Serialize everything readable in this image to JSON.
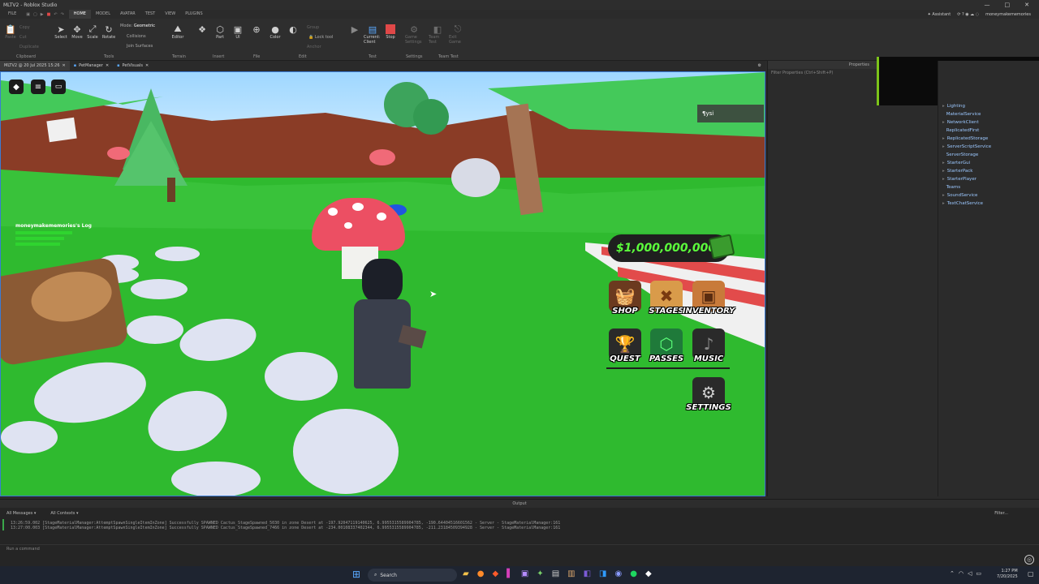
{
  "window": {
    "title": "MLTV2 - Roblox Studio",
    "min": "—",
    "max": "□",
    "close": "✕"
  },
  "menubar": {
    "file": "FILE",
    "tabs": [
      "HOME",
      "MODEL",
      "AVATAR",
      "TEST",
      "VIEW",
      "PLUGINS"
    ],
    "assistant": "Assistant",
    "user": "moneymakememories"
  },
  "ribbon": {
    "clipboard": [
      "Copy",
      "Cut",
      "Paste",
      "Duplicate"
    ],
    "tools": [
      "Select",
      "Move",
      "Scale",
      "Rotate"
    ],
    "mode_label": "Mode:",
    "mode_value": "Geometric",
    "collisions": "Collisions",
    "join_surfaces": "Join Surfaces",
    "terrain": "Editor",
    "insert": [
      "Part",
      "UI"
    ],
    "file": [
      "Import 3D"
    ],
    "edit": [
      "Material",
      "Color",
      "Group",
      "Lock"
    ],
    "lock_tool": "Lock tool",
    "anchor": "Anchor",
    "test": [
      "Play",
      "Current: Client",
      "Stop"
    ],
    "settings": "Game Settings",
    "team_test": [
      "Team Test",
      "Exit Game"
    ],
    "groups": [
      "Clipboard",
      "Tools",
      "Terrain",
      "Insert",
      "File",
      "Edit",
      "Test",
      "Settings",
      "Team Test"
    ]
  },
  "doc_tabs": [
    {
      "label": "MLTV2 @ 20 Jul 2025 15:26",
      "active": true
    },
    {
      "label": "PetManager",
      "active": false
    },
    {
      "label": "PetVisuals",
      "active": false
    }
  ],
  "game": {
    "chat_text": "ysi",
    "player_log": "moneymakememories's Log",
    "currency": "$1,000,000,000",
    "buttons": [
      {
        "label": "SHOP",
        "icon": "basket-icon"
      },
      {
        "label": "STAGES",
        "icon": "map-icon"
      },
      {
        "label": "INVENTORY",
        "icon": "backpack-icon"
      },
      {
        "label": "QUEST",
        "icon": "trophy-icon"
      },
      {
        "label": "PASSES",
        "icon": "pass-icon"
      },
      {
        "label": "MUSIC",
        "icon": "music-icon"
      },
      {
        "label": "SETTINGS",
        "icon": "gear-icon"
      }
    ]
  },
  "properties": {
    "title": "Properties",
    "filter": "Filter Properties (Ctrl+Shift+P)"
  },
  "explorer": {
    "items": [
      "Lighting",
      "MaterialService",
      "NetworkClient",
      "ReplicatedFirst",
      "ReplicatedStorage",
      "ServerScriptService",
      "ServerStorage",
      "StarterGui",
      "StarterPack",
      "StarterPlayer",
      "Teams",
      "SoundService",
      "TextChatService"
    ]
  },
  "output": {
    "title": "Output",
    "filter_messages": "All Messages",
    "filter_contexts": "All Contexts",
    "filter": "Filter...",
    "lines": [
      "13:26:59.002  [StageMaterialManager:AttemptSpawnSingleItemInZone] Successfully SPAWNED Cactus_StageSpawned_5030 in zone Desert at -197.92047119140625, 6.9955315589904785, -190.64404516601562  -  Server - StageMaterialManager:161",
      "13:27:00.003  [StageMaterialManager:AttemptSpawnSingleItemInZone] Successfully SPAWNED Cactus_StageSpawned_7466 in zone Desert at -234.00108337402344, 6.9955315589904785, -211.23184509394928  -  Server - StageMaterialManager:161"
    ],
    "command_placeholder": "Run a command"
  },
  "taskbar": {
    "search": "Search",
    "time": "1:27 PM",
    "date": "7/20/2025"
  }
}
